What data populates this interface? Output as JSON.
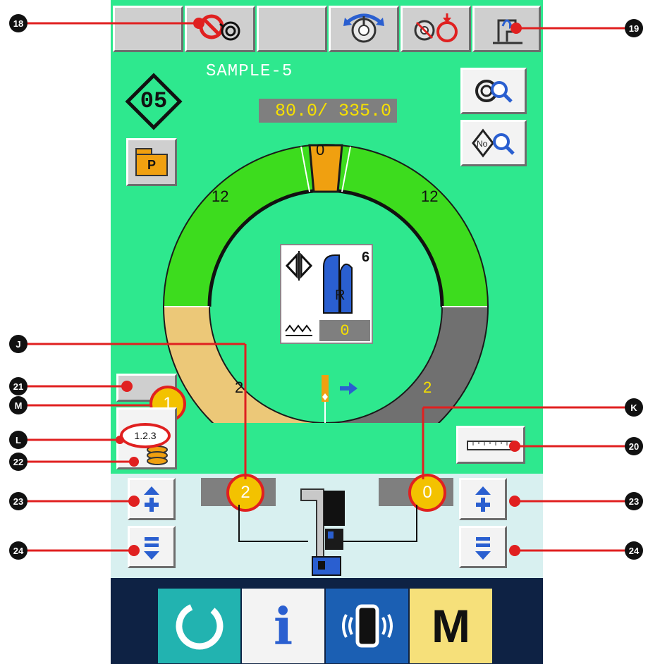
{
  "pattern": {
    "name": "SAMPLE-5",
    "number": "05",
    "stitch_readout": "80.0/ 335.0",
    "folder_label": "P"
  },
  "ring": {
    "top_value": "0",
    "upper_left_value": "12",
    "upper_right_value": "12",
    "lower_left_value": "2",
    "lower_right_value": "2"
  },
  "center_panel": {
    "count": "6",
    "side_label": "R",
    "stitch_value": "0"
  },
  "side_buttons": {
    "counter_value": "1",
    "step_label": "1.2.3"
  },
  "lower": {
    "left_value": "2",
    "right_value": "0"
  },
  "callouts": {
    "c18": "18",
    "c19": "19",
    "c20": "20",
    "c21": "21",
    "c22": "22",
    "c23a": "23",
    "c23b": "23",
    "c24a": "24",
    "c24b": "24",
    "cJ": "J",
    "cK": "K",
    "cL": "L",
    "cM": "M"
  },
  "bottom_bar": {
    "info_glyph": "i",
    "mode_label": "M"
  },
  "colors": {
    "screen_bg": "#2ee88e",
    "ring_green": "#3ddc1e",
    "ring_tan": "#ecc878",
    "ring_gray": "#707070",
    "top_segment": "#f0a010",
    "lower_panel": "#d8f0f0",
    "bottom_bar": "#0e2244",
    "callout_red": "#e02020"
  },
  "icons": {
    "top_bar": [
      "blank-key-icon",
      "no-thread-trimmer-icon",
      "blank-key-icon",
      "bobbin-rotate-icon",
      "bobbin-winder-icon",
      "presser-lift-icon"
    ],
    "right": [
      "pattern-search-icon",
      "number-search-icon"
    ],
    "bottom": [
      "ready-key-icon",
      "information-icon",
      "communication-icon",
      "mode-key-icon"
    ]
  }
}
